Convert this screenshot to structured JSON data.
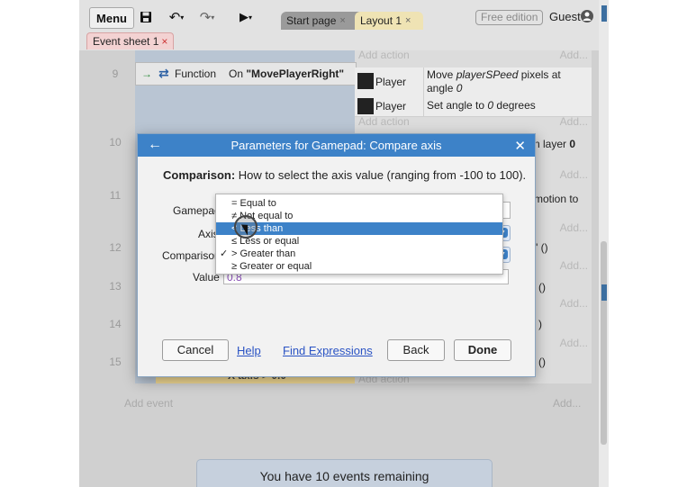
{
  "toolbar": {
    "menu_label": "Menu",
    "save_icon": "save-icon",
    "undo_icon": "undo-icon",
    "redo_icon": "redo-icon",
    "play_icon": "play-icon",
    "undo_glyph": "↶",
    "redo_glyph": "↷",
    "play_glyph": "▶",
    "dropdown_glyph": "▾",
    "tabs": [
      {
        "label": "Start page",
        "close": "×"
      },
      {
        "label": "Layout 1",
        "close": "×"
      }
    ],
    "edition_badge": "Free edition",
    "user_label": "Guest"
  },
  "sheet_tab": {
    "label": "Event sheet 1",
    "close": "×"
  },
  "event_sheet": {
    "add_action_label": "Add action",
    "add_right_label": "Add...",
    "add_event_label": "Add event",
    "row_numbers": [
      "9",
      "10",
      "11",
      "12",
      "13",
      "14",
      "15"
    ],
    "function_row": {
      "arrow": "→",
      "icon_glyph": "⇄",
      "type_label": "Function",
      "on_keyword": "On",
      "function_name": "\"MovePlayerRight\""
    },
    "actions": [
      {
        "object": "Player",
        "text_pre": "Move ",
        "text_em": "playerSPeed",
        "text_mid": " pixels at angle ",
        "text_em2": "0"
      },
      {
        "object": "Player",
        "text_pre": "Set angle to ",
        "text_em": "0",
        "text_mid": " degrees",
        "text_em2": ""
      }
    ],
    "partial_texts": {
      "layer0_pre": "n layer ",
      "layer0_val": "0",
      "motion_to": "motion to",
      "quote_call": "\" ()",
      "call_13": "()",
      "call_14": ")",
      "call_15": "()"
    },
    "yellow_condition": "X axis > 0.0",
    "events_remaining": "You have 10 events remaining"
  },
  "dialog": {
    "back_glyph": "←",
    "title": "Parameters for Gamepad: Compare axis",
    "close_glyph": "✕",
    "description_label": "Comparison:",
    "description_text": " How to select the axis value (ranging from -100 to 100).",
    "params": {
      "gamepad_label": "Gamepad",
      "axis_label": "Axis",
      "comparison_label": "Comparison",
      "value_label": "Value",
      "value": "0.8"
    },
    "comparison_options": [
      {
        "label": "= Equal to",
        "checked": false,
        "selected": false
      },
      {
        "label": "≠ Not equal to",
        "checked": false,
        "selected": false
      },
      {
        "label": "< Less than",
        "checked": false,
        "selected": true
      },
      {
        "label": "≤ Less or equal",
        "checked": false,
        "selected": false
      },
      {
        "label": "> Greater than",
        "checked": true,
        "selected": false
      },
      {
        "label": "≥ Greater or equal",
        "checked": false,
        "selected": false
      }
    ],
    "check_glyph": "✓",
    "buttons": {
      "cancel": "Cancel",
      "help": "Help",
      "find_expressions": "Find Expressions",
      "back": "Back",
      "done": "Done"
    }
  },
  "colors": {
    "accent": "#3d82c8",
    "condition_bg": "#b9c5d3",
    "highlight_yellow": "#f0d893"
  }
}
